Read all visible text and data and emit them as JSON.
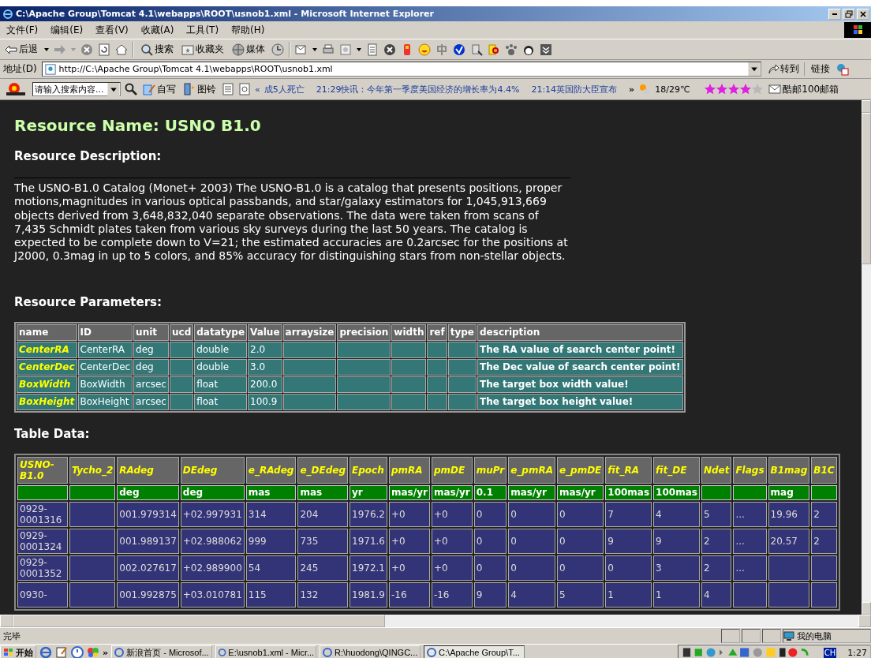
{
  "window": {
    "title": "C:\\Apache Group\\Tomcat 4.1\\webapps\\ROOT\\usnob1.xml - Microsoft Internet Explorer"
  },
  "menu": [
    "文件(F)",
    "编辑(E)",
    "查看(V)",
    "收藏(A)",
    "工具(T)",
    "帮助(H)"
  ],
  "toolbar": {
    "back": "后退",
    "search": "搜索",
    "favorites": "收藏夹",
    "media": "媒体"
  },
  "address": {
    "label": "地址(D)",
    "url": "http://C:\\Apache Group\\Tomcat 4.1\\webapps\\ROOT\\usnob1.xml",
    "go": "转到",
    "links": "链接"
  },
  "sina_bar": {
    "search_value": "请输入搜索内容...",
    "write": "自写",
    "ringtone": "图铃",
    "news_prev": "«",
    "news": [
      "成5人死亡",
      "21:29快讯：今年第一季度美国经济的增长率为4.4%",
      "21:14英国防大臣宣布"
    ],
    "more": "»",
    "weather": "18/29℃",
    "stars": 4,
    "mail": "酷邮100邮箱"
  },
  "page": {
    "title": "Resource Name: USNO B1.0",
    "description_heading": "Resource Description:",
    "description": "The USNO-B1.0 Catalog (Monet+ 2003) The USNO-B1.0 is a catalog that presents positions, proper motions,magnitudes in various optical passbands, and star/galaxy estimators for 1,045,913,669 objects derived from 3,648,832,040 separate observations. The data were taken from scans of 7,435 Schmidt plates taken from various sky surveys during the last 50 years. The catalog is expected to be complete down to V=21; the estimated accuracies are 0.2arcsec for the positions at J2000, 0.3mag in up to 5 colors, and 85% accuracy for distinguishing stars from non-stellar objects.",
    "parameters_heading": "Resource Parameters:",
    "parameters": {
      "columns": [
        "name",
        "ID",
        "unit",
        "ucd",
        "datatype",
        "Value",
        "arraysize",
        "precision",
        "width",
        "ref",
        "type",
        "description"
      ],
      "rows": [
        [
          "CenterRA",
          "CenterRA",
          "deg",
          null,
          "double",
          "2.0",
          null,
          null,
          null,
          null,
          null,
          "The RA value of search center point!"
        ],
        [
          "CenterDec",
          "CenterDec",
          "deg",
          null,
          "double",
          "3.0",
          null,
          null,
          null,
          null,
          null,
          "The Dec value of search center point!"
        ],
        [
          "BoxWidth",
          "BoxWidth",
          "arcsec",
          null,
          "float",
          "200.0",
          null,
          null,
          null,
          null,
          null,
          "The target box width value!"
        ],
        [
          "BoxHeight",
          "BoxHeight",
          "arcsec",
          null,
          "float",
          "100.9",
          null,
          null,
          null,
          null,
          null,
          "The target box height value!"
        ]
      ]
    },
    "table_heading": "Table Data:",
    "table": {
      "columns": [
        {
          "name": "USNO-B1.0"
        },
        {
          "name": "Tycho_2"
        },
        {
          "name": "RAdeg",
          "unit": "deg"
        },
        {
          "name": "DEdeg",
          "unit": "deg"
        },
        {
          "name": "e_RAdeg",
          "unit": "mas"
        },
        {
          "name": "e_DEdeg",
          "unit": "mas"
        },
        {
          "name": "Epoch",
          "unit": "yr"
        },
        {
          "name": "pmRA",
          "unit": "mas/yr"
        },
        {
          "name": "pmDE",
          "unit": "mas/yr"
        },
        {
          "name": "muPr",
          "unit": "0.1"
        },
        {
          "name": "e_pmRA",
          "unit": "mas/yr"
        },
        {
          "name": "e_pmDE",
          "unit": "mas/yr"
        },
        {
          "name": "fit_RA",
          "unit": "100mas"
        },
        {
          "name": "fit_DE",
          "unit": "100mas"
        },
        {
          "name": "Ndet"
        },
        {
          "name": "Flags"
        },
        {
          "name": "B1mag",
          "unit": "mag"
        },
        {
          "name": "B1C"
        }
      ],
      "rows": [
        [
          "0929-0001316",
          null,
          "001.979314",
          "+02.997931",
          "314",
          "204",
          "1976.2",
          "+0",
          "+0",
          "0",
          "0",
          "0",
          "7",
          "4",
          "5",
          "...",
          "19.96",
          "2"
        ],
        [
          "0929-0001324",
          null,
          "001.989137",
          "+02.988062",
          "999",
          "735",
          "1971.6",
          "+0",
          "+0",
          "0",
          "0",
          "0",
          "9",
          "9",
          "2",
          "...",
          "20.57",
          "2"
        ],
        [
          "0929-0001352",
          null,
          "002.027617",
          "+02.989900",
          "54",
          "245",
          "1972.1",
          "+0",
          "+0",
          "0",
          "0",
          "0",
          "0",
          "3",
          "2",
          "...",
          null,
          null
        ],
        [
          "0930-",
          null,
          "001.992875",
          "+03.010781",
          "115",
          "132",
          "1981.9",
          "-16",
          "-16",
          "9",
          "4",
          "5",
          "1",
          "1",
          "4",
          null,
          null,
          null
        ]
      ]
    }
  },
  "status_bar": {
    "text": "完毕",
    "zone": "我的电脑"
  },
  "taskbar": {
    "start": "开始",
    "more": "»",
    "tasks": [
      {
        "label": "新浪首页 - Microsof...",
        "selected": false
      },
      {
        "label": "E:\\usnob1.xml - Micr...",
        "selected": false
      },
      {
        "label": "R:\\huodong\\QINGC...",
        "selected": false
      },
      {
        "label": "C:\\Apache Group\\T...",
        "selected": true
      }
    ],
    "language": "CH",
    "clock": "1:27"
  }
}
